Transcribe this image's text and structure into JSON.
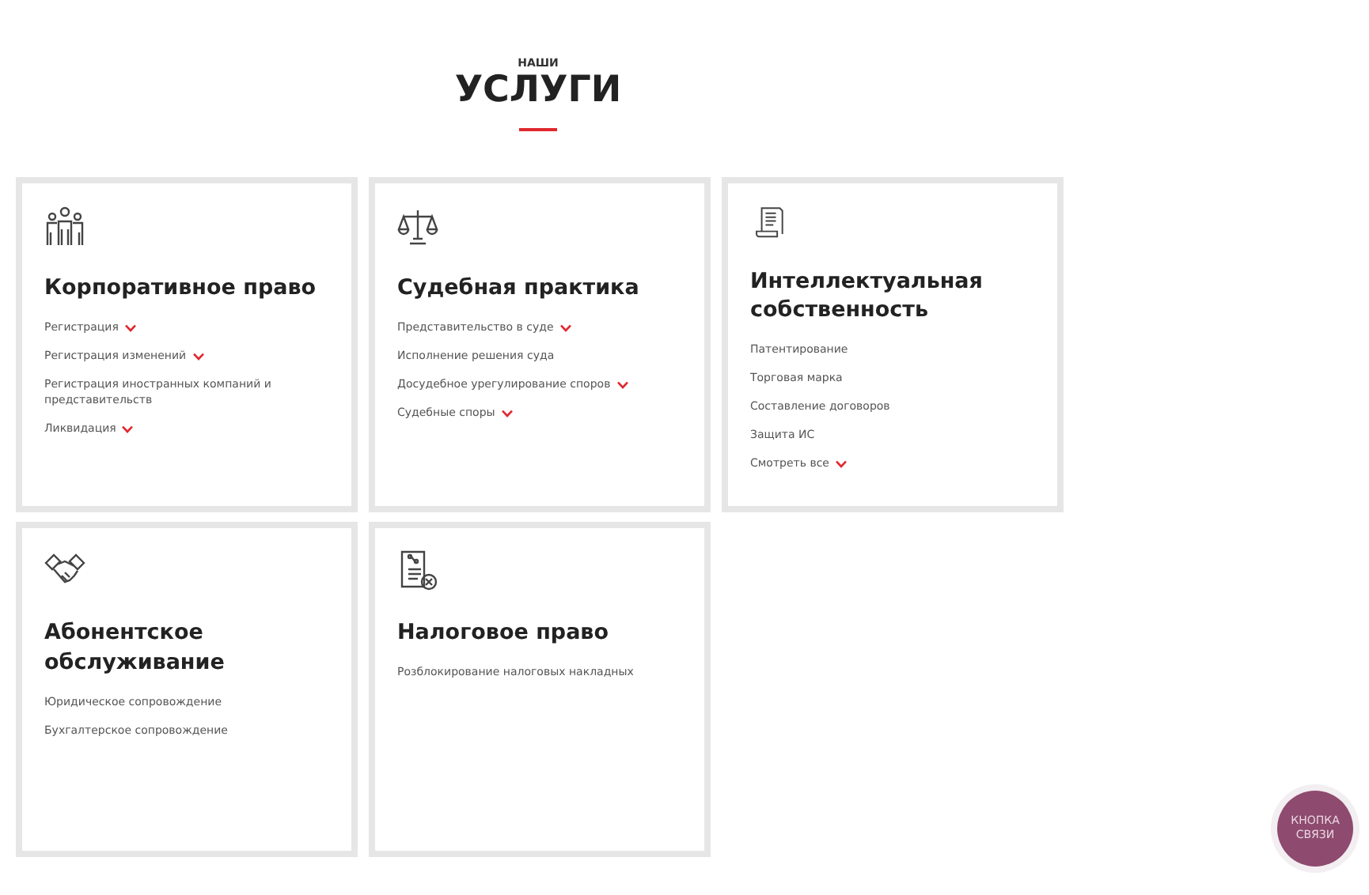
{
  "heading": {
    "overline": "НАШИ",
    "title": "УСЛУГИ"
  },
  "services": [
    {
      "kind": "people",
      "title": "Корпоративное право",
      "items": [
        {
          "label": "Регистрация",
          "expandable": true
        },
        {
          "label": "Регистрация изменений",
          "expandable": true
        },
        {
          "label": "Регистрация иностранных компаний и представительств",
          "expandable": false
        },
        {
          "label": "Ликвидация",
          "expandable": true
        }
      ]
    },
    {
      "kind": "scales",
      "title": "Судебная практика",
      "items": [
        {
          "label": "Представительство в суде",
          "expandable": true
        },
        {
          "label": "Исполнение решения суда",
          "expandable": false
        },
        {
          "label": "Досудебное урегулирование споров",
          "expandable": true
        },
        {
          "label": "Судебные споры",
          "expandable": true
        }
      ]
    },
    {
      "kind": "scroll",
      "title": "Интеллектуальная собственность",
      "items": [
        {
          "label": "Патентирование",
          "expandable": false
        },
        {
          "label": "Торговая марка",
          "expandable": false
        },
        {
          "label": "Составление договоров",
          "expandable": false
        },
        {
          "label": "Защита ИС",
          "expandable": false
        },
        {
          "label": "Смотреть все",
          "expandable": true
        }
      ]
    },
    {
      "kind": "handshake",
      "title": "Абонентское обслуживание",
      "items": [
        {
          "label": "Юридическое сопровождение",
          "expandable": false
        },
        {
          "label": "Бухгалтерское сопровождение",
          "expandable": false
        }
      ]
    },
    {
      "kind": "tax",
      "title": "Налоговое право",
      "items": [
        {
          "label": "Розблокирование налоговых накладных",
          "expandable": false
        }
      ]
    }
  ],
  "contact_button": "КНОПКА СВЯЗИ"
}
